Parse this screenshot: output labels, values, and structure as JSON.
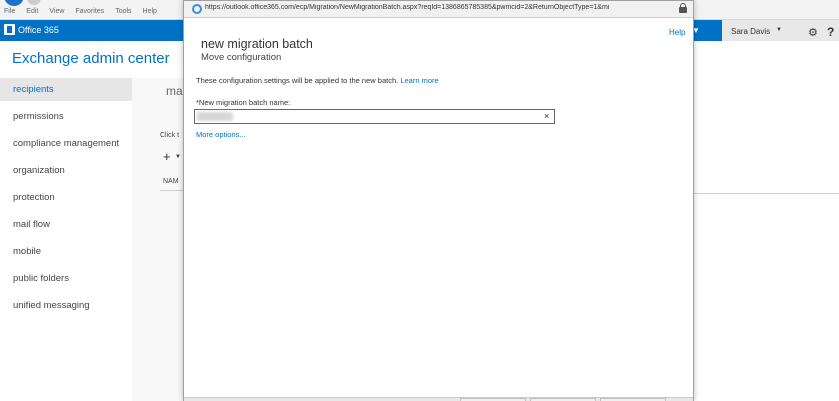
{
  "browser": {
    "menu": [
      "File",
      "Edit",
      "View",
      "Favorites",
      "Tools",
      "Help"
    ]
  },
  "o365": {
    "brand": "Office 365",
    "user_name": "Sara Davis"
  },
  "eac": {
    "title": "Exchange admin center",
    "nav": [
      {
        "label": "recipients",
        "active": true
      },
      {
        "label": "permissions"
      },
      {
        "label": "compliance management"
      },
      {
        "label": "organization"
      },
      {
        "label": "protection"
      },
      {
        "label": "mail flow"
      },
      {
        "label": "mobile"
      },
      {
        "label": "public folders"
      },
      {
        "label": "unified messaging"
      }
    ],
    "content_heading": "ma",
    "click_hint": "Click t",
    "column_header": "NAM"
  },
  "popup": {
    "url": "https://outlook.office365.com/ecp/Migration/NewMigrationBatch.aspx?reqId=1386865785385&pwmcid=2&ReturnObjectType=1&mi",
    "help": "Help",
    "title": "new migration batch",
    "subtitle": "Move configuration",
    "description": "These configuration settings will be applied to the new batch.",
    "learn_more": "Learn more",
    "field_label": "*New migration batch name:",
    "field_value": "",
    "more_options": "More options..."
  },
  "colors": {
    "office_blue": "#0072c6",
    "link_blue": "#0072c6"
  }
}
